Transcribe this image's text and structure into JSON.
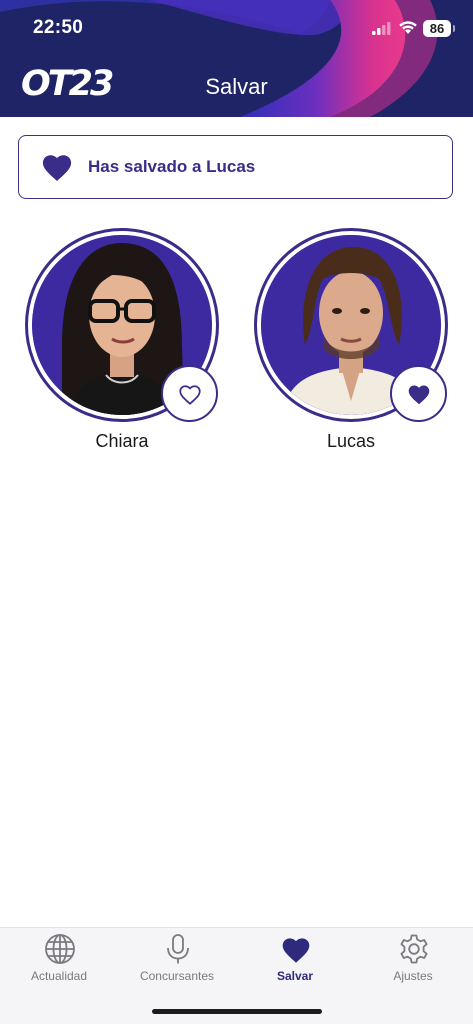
{
  "status_bar": {
    "time": "22:50",
    "battery_level": "86"
  },
  "header": {
    "logo_text": "OT23",
    "title": "Salvar"
  },
  "banner": {
    "text": "Has salvado a Lucas",
    "icon": "heart-icon"
  },
  "contestants": [
    {
      "name": "Chiara",
      "saved": false,
      "heart_icon": "heart-outline-icon"
    },
    {
      "name": "Lucas",
      "saved": true,
      "heart_icon": "heart-filled-icon"
    }
  ],
  "tabs": [
    {
      "label": "Actualidad",
      "icon": "globe-icon",
      "active": false
    },
    {
      "label": "Concursantes",
      "icon": "microphone-icon",
      "active": false
    },
    {
      "label": "Salvar",
      "icon": "heart-icon",
      "active": true
    },
    {
      "label": "Ajustes",
      "icon": "gear-icon",
      "active": false
    }
  ],
  "colors": {
    "header_bg": "#1f2466",
    "accent": "#3a2d8a",
    "magenta": "#e0338f",
    "tab_active": "#2e2a7c",
    "tab_inactive": "#7a7a7f"
  }
}
